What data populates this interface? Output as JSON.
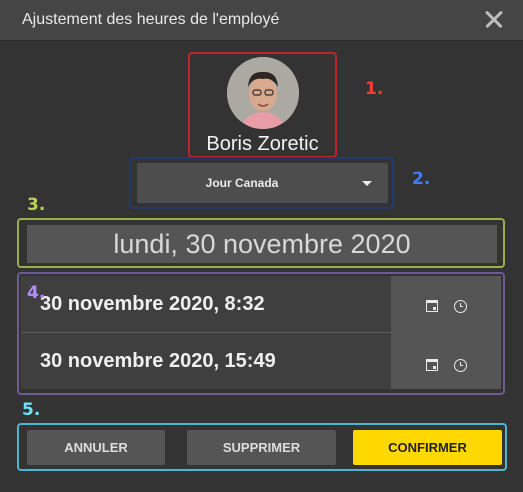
{
  "dialog": {
    "title": "Ajustement des heures de l'employé"
  },
  "employee": {
    "name": "Boris Zoretic"
  },
  "schedule": {
    "selected_option": "Jour Canada"
  },
  "date": {
    "label": "lundi, 30 novembre 2020"
  },
  "punches": [
    {
      "label": "30 novembre 2020, 8:32"
    },
    {
      "label": "30 novembre 2020, 15:49"
    }
  ],
  "actions": {
    "cancel_label": "ANNULER",
    "delete_label": "SUPPRIMER",
    "confirm_label": "CONFIRMER"
  },
  "annotations": {
    "one": "1.",
    "two": "2.",
    "three": "3.",
    "four": "4.",
    "five": "5."
  },
  "colors": {
    "background": "#333333",
    "confirm": "#ffd800",
    "annotation_1": "#c0242a",
    "annotation_2": "#253a6b",
    "annotation_3": "#9aad4f",
    "annotation_4": "#6b5b8e",
    "annotation_5": "#4bb6d0"
  }
}
